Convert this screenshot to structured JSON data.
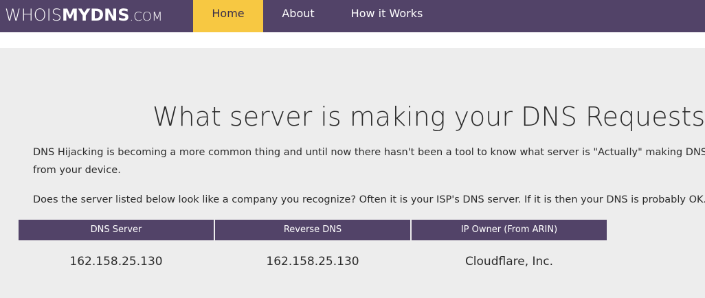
{
  "logo": {
    "part1": "WHOIS",
    "part2": "MYDNS",
    "part3": ".COM"
  },
  "nav": {
    "home": "Home",
    "about": "About",
    "how": "How it Works"
  },
  "headline": "What server is making your DNS Requests?",
  "intro": {
    "line1": "DNS Hijacking is becoming a more common thing and until now there hasn't been a tool to know what server is \"Actually\" making DNS requ",
    "line2": "from your device.",
    "question": "Does the server listed below look like a company you recognize? Often it is your ISP's DNS server. If it is then your DNS is probably OK."
  },
  "table": {
    "headers": [
      "DNS Server",
      "Reverse DNS",
      "IP Owner (From ARIN)"
    ],
    "rows": [
      [
        "162.158.25.130",
        "162.158.25.130",
        "Cloudflare, Inc."
      ]
    ]
  },
  "colors": {
    "nav_bg": "#524368",
    "active_tab": "#f7c842",
    "page_bg": "#ededed"
  }
}
